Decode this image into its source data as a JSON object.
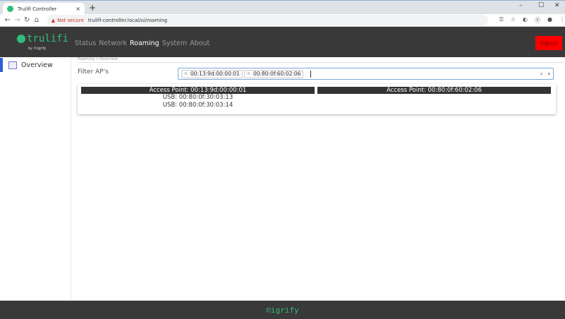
{
  "browser": {
    "tab_title": "Trulifi Controller",
    "security": "Not secure",
    "url": "trulifi-controller.local/ui/roaming"
  },
  "app": {
    "logo": "trulifi",
    "byline": "by ©igrify",
    "logout": "logout",
    "footer": "©igrify",
    "menu": [
      {
        "label": "Status"
      },
      {
        "label": "Network"
      },
      {
        "label": "Roaming"
      },
      {
        "label": "System"
      },
      {
        "label": "About"
      }
    ]
  },
  "sidebar": {
    "items": [
      {
        "label": "Overview"
      }
    ]
  },
  "breadcrumb": "Roaming » Overview",
  "filter": {
    "label": "Filter AP's",
    "selected": [
      "00:13:9d:00:00:01",
      "00:80:0f:60:02:06"
    ]
  },
  "access_points": [
    {
      "title": "Access Point: 00:13:9d:00:00:01",
      "devices": [
        "USB: 00:80:0f:30:03:13",
        "USB: 00:80:0f:30:03:14"
      ]
    },
    {
      "title": "Access Point: 00:80:0f:60:02:06",
      "devices": []
    }
  ]
}
